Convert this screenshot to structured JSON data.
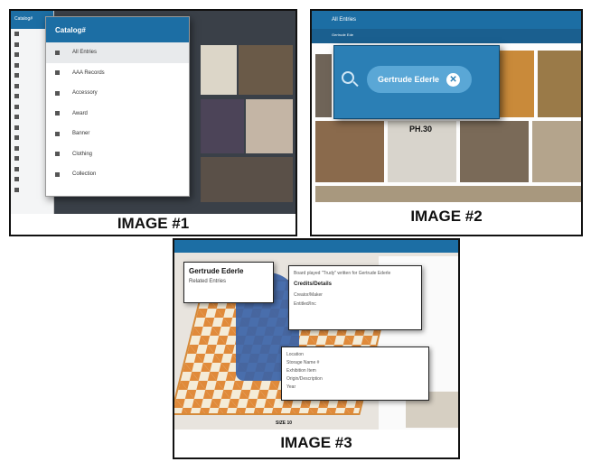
{
  "captions": [
    "IMAGE #1",
    "IMAGE #2",
    "IMAGE #3"
  ],
  "panel1": {
    "app_title": "Catalog#",
    "menu_title": "Catalog#",
    "menu_items": [
      "All Entries",
      "AAA Records",
      "Accessory",
      "Award",
      "Banner",
      "Clothing",
      "Collection"
    ]
  },
  "panel2": {
    "app_title": "All Entries",
    "chip_small": "Gertrude Ede",
    "search_term": "Gertrude Ederle",
    "clear_symbol": "✕",
    "photo_caption": "PH.30"
  },
  "panel3": {
    "title": "Gertrude Ederle",
    "subtitle": "Related Entries",
    "desc_line": "Board played \"Trudy\" written for Gertrude Ederle",
    "section_heading": "Credits/Details",
    "credit_lines": [
      "Creator/Maker",
      "Entitled/Inc"
    ],
    "detail_lines": [
      "Location",
      "Storage Name #",
      "Exhibition Item",
      "Origin/Description",
      "Year"
    ],
    "bottom_label": "SIZE 10"
  },
  "colors": {
    "primary": "#1c6ea4",
    "search": "#2b7fb5",
    "pill": "#5aa7d6"
  }
}
